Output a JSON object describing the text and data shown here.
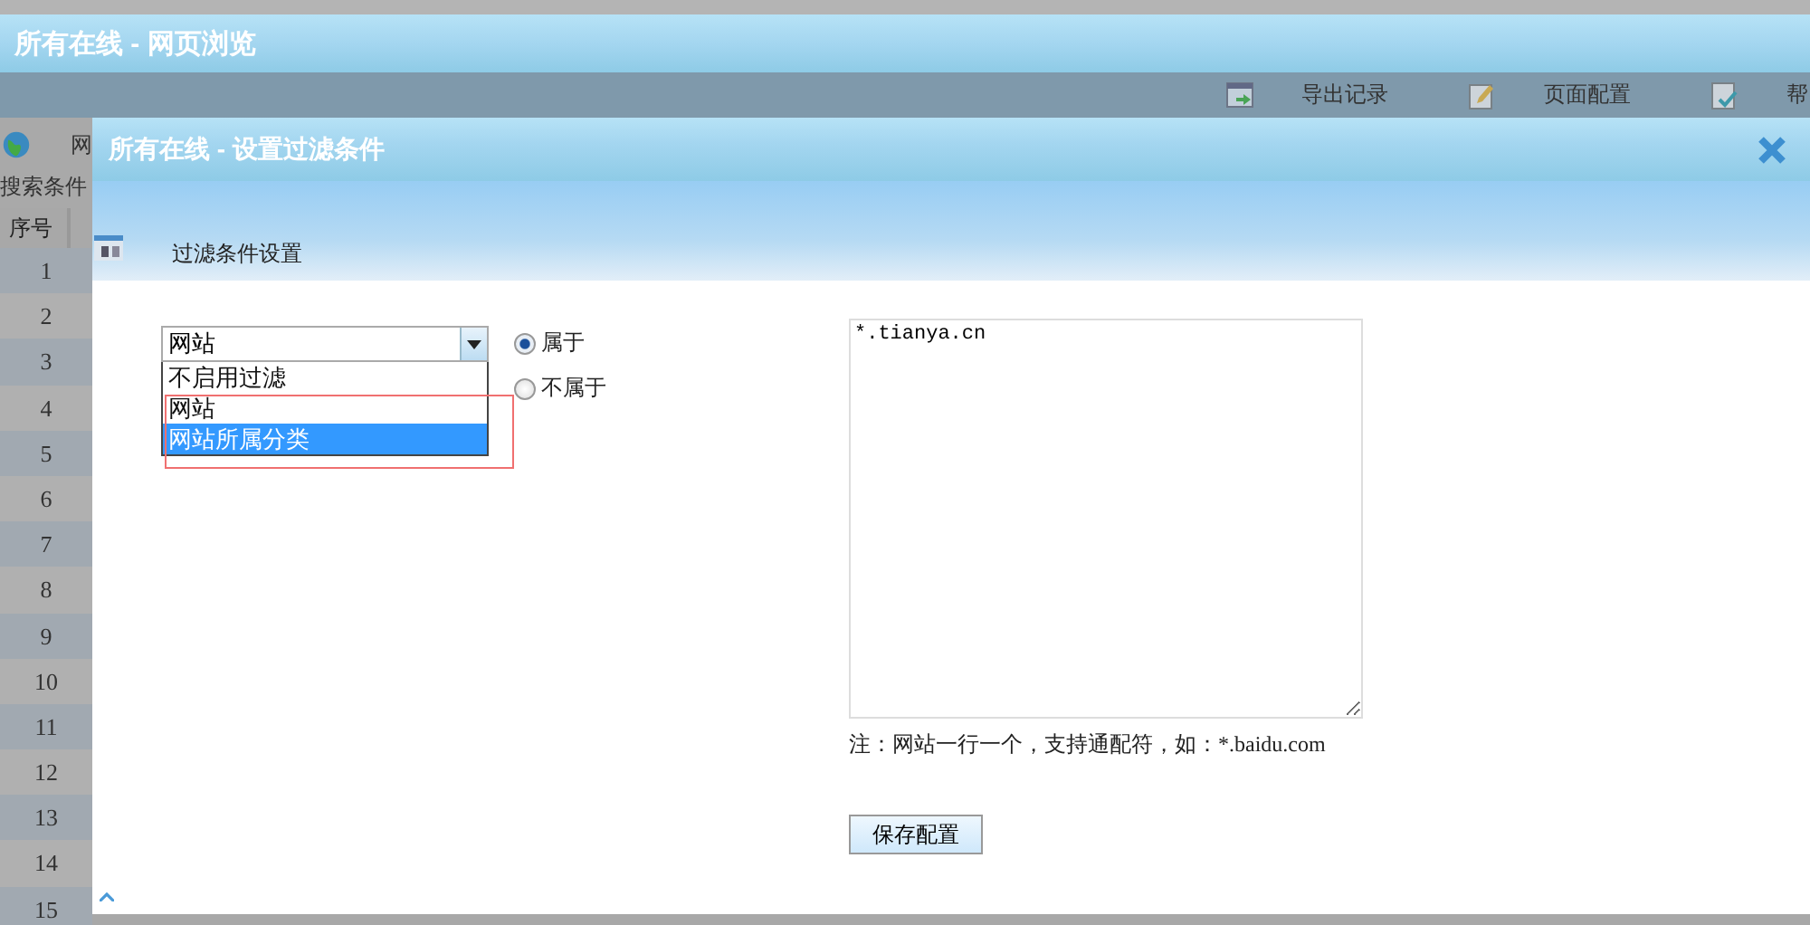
{
  "app": {
    "title": "所有在线 - 网页浏览",
    "toolbar": [
      {
        "kind": "export",
        "label": "导出记录"
      },
      {
        "kind": "edit",
        "label": "页面配置"
      },
      {
        "kind": "check",
        "label": "帮"
      }
    ],
    "tab_label": "网",
    "search_label": "搜索条件",
    "column_1": "序号",
    "row_numbers": [
      "1",
      "2",
      "3",
      "4",
      "5",
      "6",
      "7",
      "8",
      "9",
      "10",
      "11",
      "12",
      "13",
      "14",
      "15"
    ]
  },
  "dialog": {
    "title": "所有在线 - 设置过滤条件",
    "section": "过滤条件设置",
    "filter_select": {
      "value": "网站",
      "expanded": true,
      "options": [
        {
          "label": "不启用过滤",
          "highlighted": false
        },
        {
          "label": "网站",
          "highlighted": false
        },
        {
          "label": "网站所属分类",
          "highlighted": true
        }
      ]
    },
    "match": [
      {
        "label": "属于",
        "selected": true
      },
      {
        "label": "不属于",
        "selected": false
      }
    ],
    "sites": {
      "value": "*.tianya.cn"
    },
    "note": "注：网站一行一个，支持通配符，如：*.baidu.com",
    "save_button": "保存配置"
  }
}
